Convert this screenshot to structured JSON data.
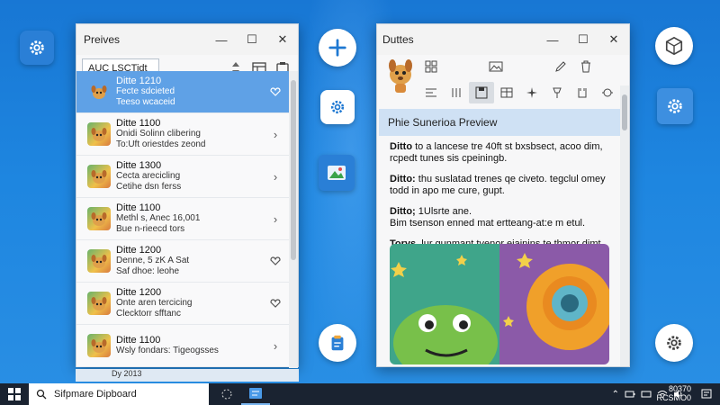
{
  "colors": {
    "desktop": "#1e86e0",
    "selection": "#5fa1e6",
    "taskbar": "#1a2331",
    "accent": "#2a7fd6"
  },
  "left_window": {
    "title": "Preives",
    "search_value": "AUC LSCTidt",
    "items": [
      {
        "title": "Ditte 1210",
        "sub": "Fecte sdcieted\nTeeso wcaceid",
        "chevron": "heart-icon",
        "selected": true
      },
      {
        "title": "Ditte 1100",
        "sub": "Onidi Solinn clibering\nTo:Uft oriestdes zeond",
        "chevron": "chevron-right-icon",
        "selected": false
      },
      {
        "title": "Ditte 1300",
        "sub": "Cecta arecicling\nCetihe dsn ferss",
        "chevron": "chevron-right-icon",
        "selected": false
      },
      {
        "title": "Ditte 1100",
        "sub": "Methl s, Anec 16,001\nBue n-rieecd tors",
        "chevron": "chevron-right-icon",
        "selected": false
      },
      {
        "title": "Ditte 1200",
        "sub": "Denne, 5 zK A Sat\nSaf dhoe: leohe",
        "chevron": "heart-icon",
        "selected": false
      },
      {
        "title": "Ditte 1200",
        "sub": "Onte aren tercicing\nClecktorr sfftanc",
        "chevron": "heart-icon",
        "selected": false
      },
      {
        "title": "Ditte 1100",
        "sub": "Wsly fondars: Tigeogsses",
        "chevron": "chevron-right-icon",
        "selected": false
      }
    ],
    "below_label": "Dy 2013"
  },
  "right_window": {
    "title": "Duttes",
    "preview_title": "Phie Sunerioa Preview",
    "paragraphs": [
      {
        "bold": "Ditto",
        "text": " to a lancese tre 40ft st bxsbsect, acoo dim, rcpedt tunes sis cpeiningb."
      },
      {
        "bold": "Ditto:",
        "text": " thu suslatad trenes qe civeto. tegclul omey todd in apo me cure, gupt."
      },
      {
        "bold": "Ditto;",
        "text": " 1Ulsrte ane.\nBim tsenson enned mat ertteang-at:e m etul."
      },
      {
        "bold": "Torys,",
        "text": " lur gunmant tvenor eiainins te thmor dimt sond emast."
      }
    ]
  },
  "taskbar": {
    "search_text": "Sifpmare Dipboard",
    "clock_time": "80370",
    "clock_date": "RCSMO0"
  }
}
